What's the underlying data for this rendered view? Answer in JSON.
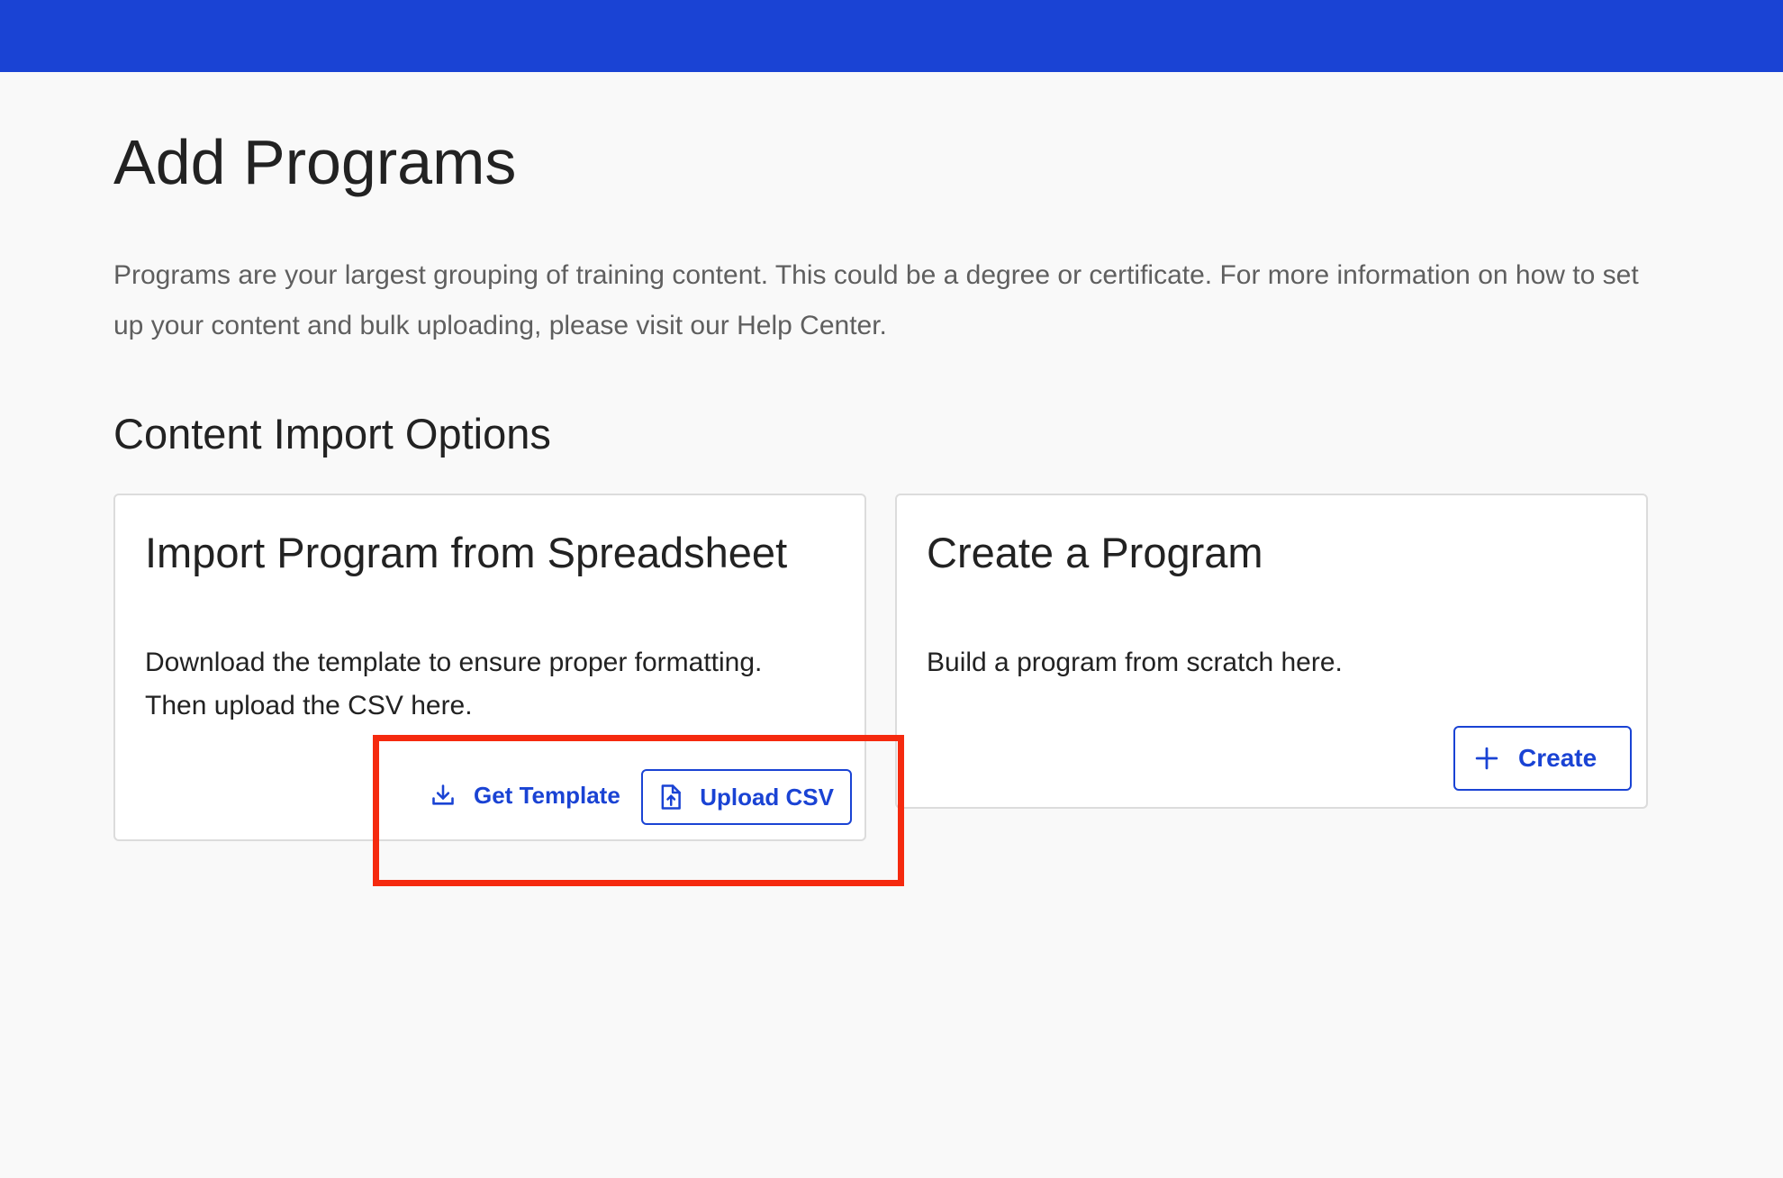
{
  "header": {
    "bar_color": "#1a43d4"
  },
  "page": {
    "title": "Add Programs",
    "description": "Programs are your largest grouping of training content. This could be a degree or certificate. For more information on how to set up your content and bulk uploading, please visit our Help Center."
  },
  "section": {
    "title": "Content Import Options"
  },
  "import_card": {
    "title": "Import Program from Spreadsheet",
    "text_lines": [
      "Download the template to ensure proper formatting.",
      "Then upload the CSV here."
    ],
    "get_template_label": "Get Template",
    "get_template_icon": "download-icon",
    "upload_csv_label": "Upload CSV",
    "upload_csv_icon": "file-upload-icon"
  },
  "create_card": {
    "title": "Create a Program",
    "text": "Build a program from scratch here.",
    "create_label": "Create",
    "create_icon": "plus-icon"
  },
  "colors": {
    "accent": "#1a43d4",
    "highlight": "#f52a0f",
    "background": "#f9f9f9"
  }
}
